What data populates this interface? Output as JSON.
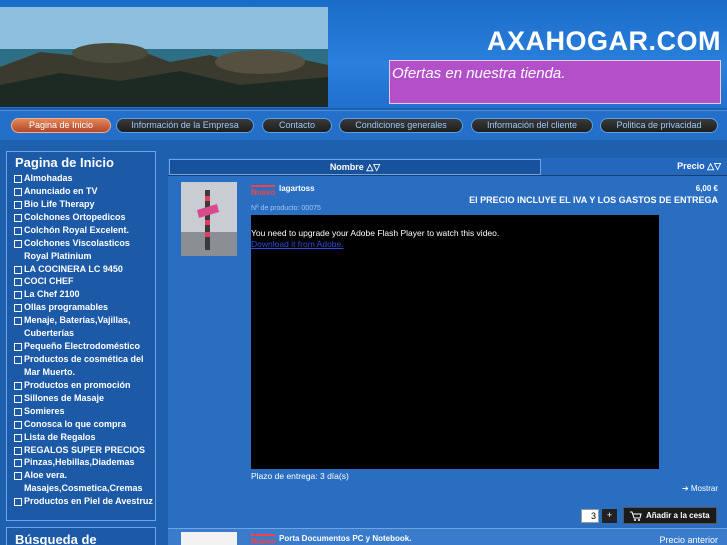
{
  "header": {
    "site_title": "AXAHOGAR.COM",
    "promo": "Ofertas en nuestra tienda."
  },
  "nav": {
    "items": [
      {
        "label": "Pagina de Inicio",
        "active": true
      },
      {
        "label": "Información de la Empresa",
        "active": false
      },
      {
        "label": "Contacto",
        "active": false
      },
      {
        "label": "Condiciones generales",
        "active": false
      },
      {
        "label": "Información del cliente",
        "active": false
      },
      {
        "label": "Politica de privacidad",
        "active": false
      }
    ]
  },
  "sidebar": {
    "title": "Pagina de Inicio",
    "categories": [
      "Almohadas",
      "Anunciado en TV",
      "Bio Life Therapy",
      "Colchones Ortopedicos",
      "Colchón Royal Excelent.",
      "Colchones Viscolasticos Royal Platinium",
      "LA COCINERA LC 9450",
      "COCI CHEF",
      "La Chef 2100",
      "Ollas programables",
      "Menaje, Baterías,Vajillas, Cuberterías",
      "Pequeño Electrodoméstico",
      "Productos de cosmética del Mar Muerto.",
      "Productos en promoción",
      "Sillones de Masaje",
      "Somieres",
      "Conosca lo que compra",
      "Lista de Regalos",
      "REGALOS SUPER PRECIOS",
      "Pinzas,Hebillas,Diademas",
      "Aloe vera. Masajes,Cosmetica,Cremas",
      "Productos en Piel de Avestruz"
    ],
    "search_title": "Búsqueda de"
  },
  "content": {
    "col_name": "Nombre △▽",
    "col_price": "Precio △▽",
    "product1": {
      "badge": "Nuevo",
      "name": "lagartoss",
      "price": "6,00 €",
      "tax_note": "El PRECIO INCLUYE EL IVA Y LOS GASTOS DE ENTREGA",
      "number": "Nº de producto: 00075",
      "flash_msg": "You need to upgrade your Adobe Flash Player to watch this video.",
      "flash_link": "Download it from Adobe.",
      "delivery": "Plazo de entrega: 3 día(s)",
      "more": "➔ Mostrar",
      "qty": "3",
      "qty_plus": "+",
      "add_cart": "Añadir a la cesta"
    },
    "product2": {
      "badge": "Nuevo",
      "name": "Porta Documentos PC y Notebook.",
      "prev": "Precio anterior"
    }
  },
  "colors": {
    "background": "#1e5fae",
    "promo_box": "#b350c9",
    "active_nav": "#c8603a",
    "badge_new": "#ff4040"
  }
}
